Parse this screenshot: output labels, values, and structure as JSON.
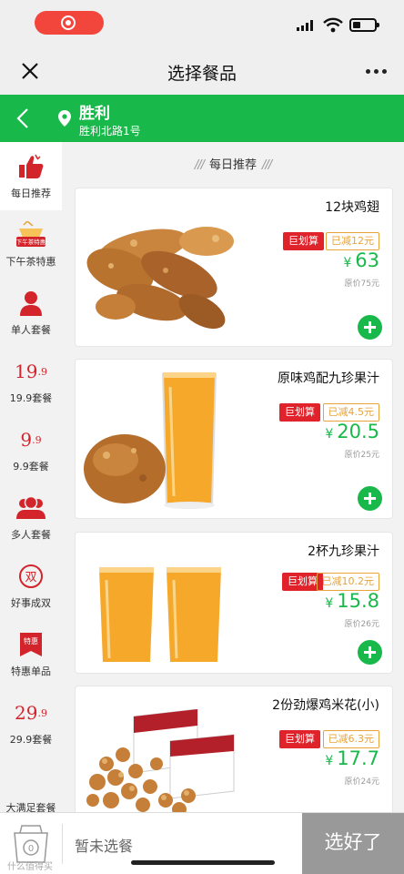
{
  "header": {
    "title": "选择餐品"
  },
  "store": {
    "name": "胜利",
    "address": "胜利北路1号"
  },
  "section": {
    "title": "每日推荐"
  },
  "sidebar": {
    "items": [
      {
        "label": "每日推荐",
        "icon": "thumbs-up-icon"
      },
      {
        "label": "下午茶特惠",
        "icon": "afternoon-tea-icon",
        "icon_text": "下午茶特惠"
      },
      {
        "label": "单人套餐",
        "icon": "single-person-icon"
      },
      {
        "label": "19.9套餐",
        "icon": "price-199-icon",
        "icon_main": "19",
        "icon_small": ".9"
      },
      {
        "label": "9.9套餐",
        "icon": "price-99-icon",
        "icon_main": "9",
        "icon_small": ".9"
      },
      {
        "label": "多人套餐",
        "icon": "group-icon"
      },
      {
        "label": "好事成双",
        "icon": "double-icon",
        "icon_text": "双"
      },
      {
        "label": "特惠单品",
        "icon": "special-tag-icon",
        "icon_text": "特惠"
      },
      {
        "label": "29.9套餐",
        "icon": "price-299-icon",
        "icon_main": "29",
        "icon_small": ".9"
      },
      {
        "label": "大满足套餐",
        "icon": "big-meal-icon"
      }
    ]
  },
  "products": [
    {
      "name": "12块鸡翅",
      "badge": "巨划算",
      "saved": "已减12元",
      "currency": "¥",
      "price": "63",
      "original": "原价75元",
      "image": "chicken-wings-image"
    },
    {
      "name": "原味鸡配九珍果汁",
      "badge": "巨划算",
      "saved": "已减4.5元",
      "currency": "¥",
      "price": "20.5",
      "original": "原价25元",
      "image": "chicken-juice-image"
    },
    {
      "name": "2杯九珍果汁",
      "badge": "巨划算",
      "saved": "已减10.2元",
      "currency": "¥",
      "price": "15.8",
      "original": "原价26元",
      "image": "two-juices-image"
    },
    {
      "name": "2份劲爆鸡米花(小)",
      "badge": "巨划算",
      "saved": "已减6.3元",
      "currency": "¥",
      "price": "17.7",
      "original": "原价24元",
      "image": "popcorn-chicken-image"
    }
  ],
  "cart": {
    "count": "0",
    "empty_text": "暂未选餐",
    "done_label": "选好了"
  },
  "watermark": "什么值得买",
  "colors": {
    "brand_green": "#18b94a",
    "accent_red": "#e0232b",
    "save_orange": "#e8a33a"
  }
}
